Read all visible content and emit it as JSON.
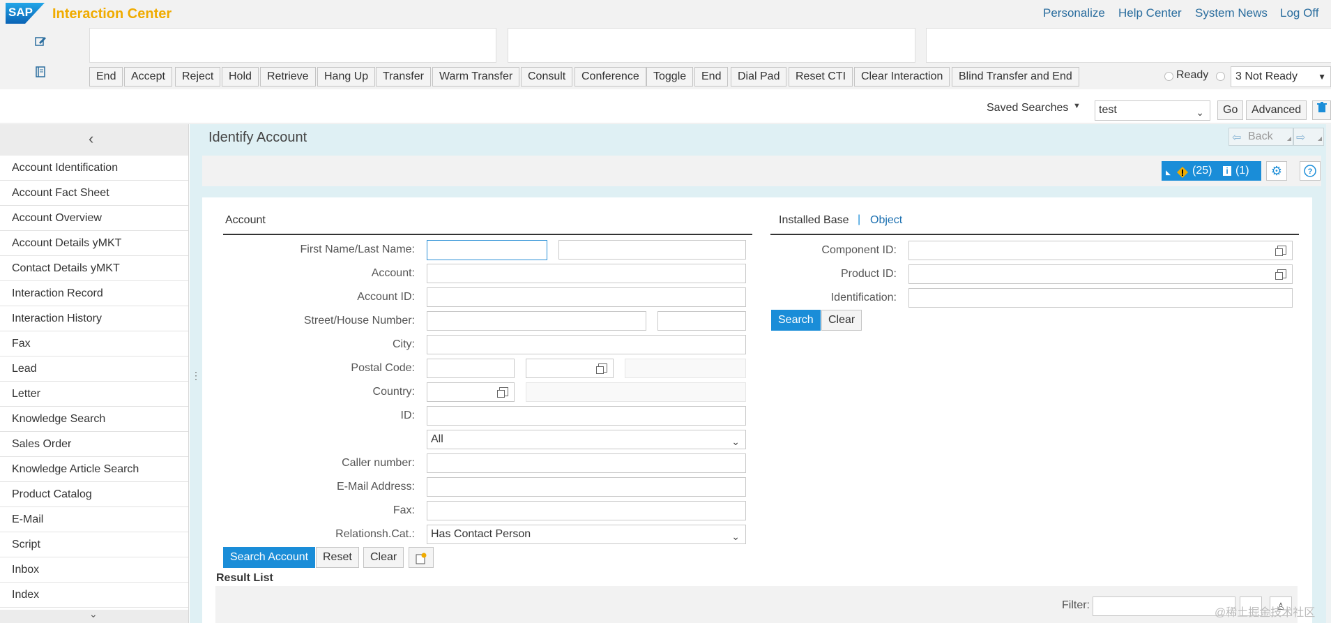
{
  "app": {
    "title": "Interaction Center",
    "logo_text": "SAP",
    "top_links": [
      "Personalize",
      "Help Center",
      "System News",
      "Log Off"
    ]
  },
  "cti": {
    "buttons": [
      "End",
      "Accept",
      "Reject",
      "Hold",
      "Retrieve",
      "Hang Up",
      "Transfer",
      "Warm Transfer",
      "Consult",
      "Conference",
      "Toggle",
      "End",
      "Dial Pad",
      "Reset CTI",
      "Clear Interaction",
      "Blind Transfer and End"
    ],
    "ready_label": "Ready",
    "status_value": "3 Not Ready"
  },
  "saved_search": {
    "label": "Saved Searches",
    "value": "test",
    "go_label": "Go",
    "advanced_label": "Advanced"
  },
  "sidebar": {
    "items": [
      "Account Identification",
      "Account Fact Sheet",
      "Account Overview",
      "Account Details yMKT",
      "Contact Details yMKT",
      "Interaction Record",
      "Interaction History",
      "Fax",
      "Lead",
      "Letter",
      "Knowledge Search",
      "Sales Order",
      "Knowledge Article Search",
      "Product Catalog",
      "E-Mail",
      "Script",
      "Inbox",
      "Index"
    ]
  },
  "page": {
    "title": "Identify Account",
    "back_label": "Back",
    "warning_count": "(25)",
    "info_count": "(1)"
  },
  "account_form": {
    "section_title": "Account",
    "labels": {
      "first_last_name": "First Name/Last Name:",
      "account": "Account:",
      "account_id": "Account ID:",
      "street": "Street/House Number:",
      "city": "City:",
      "postal_code": "Postal Code:",
      "country": "Country:",
      "id": "ID:",
      "caller_number": "Caller number:",
      "email": "E-Mail Address:",
      "fax": "Fax:",
      "relationship": "Relationsh.Cat.:"
    },
    "id_type_value": "All",
    "relationship_value": "Has Contact Person",
    "buttons": {
      "search": "Search Account",
      "reset": "Reset",
      "clear": "Clear"
    }
  },
  "installed_base": {
    "tab_installed": "Installed Base",
    "tab_object": "Object",
    "labels": {
      "component_id": "Component ID:",
      "product_id": "Product ID:",
      "identification": "Identification:"
    },
    "buttons": {
      "search": "Search",
      "clear": "Clear"
    }
  },
  "result_list": {
    "title": "Result List",
    "filter_label": "Filter:"
  },
  "watermark": "@稀土掘金技术社区",
  "colors": {
    "accent": "#1a8dd8",
    "brand_orange": "#f0ab00",
    "link": "#2a6d9e"
  }
}
